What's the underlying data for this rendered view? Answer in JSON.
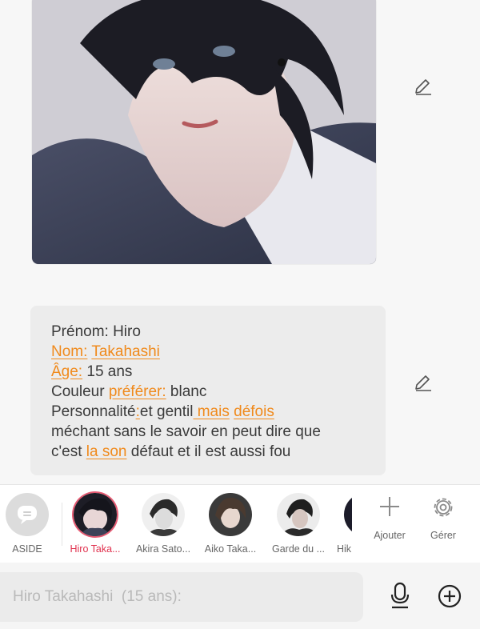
{
  "chat": {
    "image_message": {
      "alt": "portrait of character with dark hair"
    },
    "text_message": {
      "l1_plain": "Prénom: Hiro",
      "l2_a": "Nom:",
      "l2_b": "Takahashi",
      "l3_a": "Âge:",
      "l3_b": " 15 ans",
      "l4_a": "Couleur ",
      "l4_b": "préférer:",
      "l4_c": " blanc",
      "l5_a": "Personnalité",
      "l5_b": ":",
      "l5_c": "et gentil",
      "l5_d": " mais",
      "l5_e": " ",
      "l5_f": "défois",
      "l6": "méchant sans le savoir en peut dire que",
      "l7_a": "c'est ",
      "l7_b": "la son",
      "l7_c": " défaut et il est aussi fou"
    }
  },
  "characters": [
    {
      "name": "ASIDE",
      "active": false
    },
    {
      "name": "Hiro Taka...",
      "active": true
    },
    {
      "name": "Akira Sato...",
      "active": false
    },
    {
      "name": "Aiko Taka...",
      "active": false
    },
    {
      "name": "Garde du ...",
      "active": false
    },
    {
      "name": "Hik",
      "active": false
    }
  ],
  "actions": {
    "add_label": "Ajouter",
    "manage_label": "Gérer"
  },
  "input": {
    "placeholder": "Hiro Takahashi  (15 ans):",
    "value": ""
  },
  "colors": {
    "accent": "#e0314e",
    "link": "#f08a1c"
  },
  "icons": [
    "pencil-icon",
    "chat-bubble-icon",
    "plus-icon",
    "gear-icon",
    "microphone-icon",
    "add-circle-icon"
  ]
}
